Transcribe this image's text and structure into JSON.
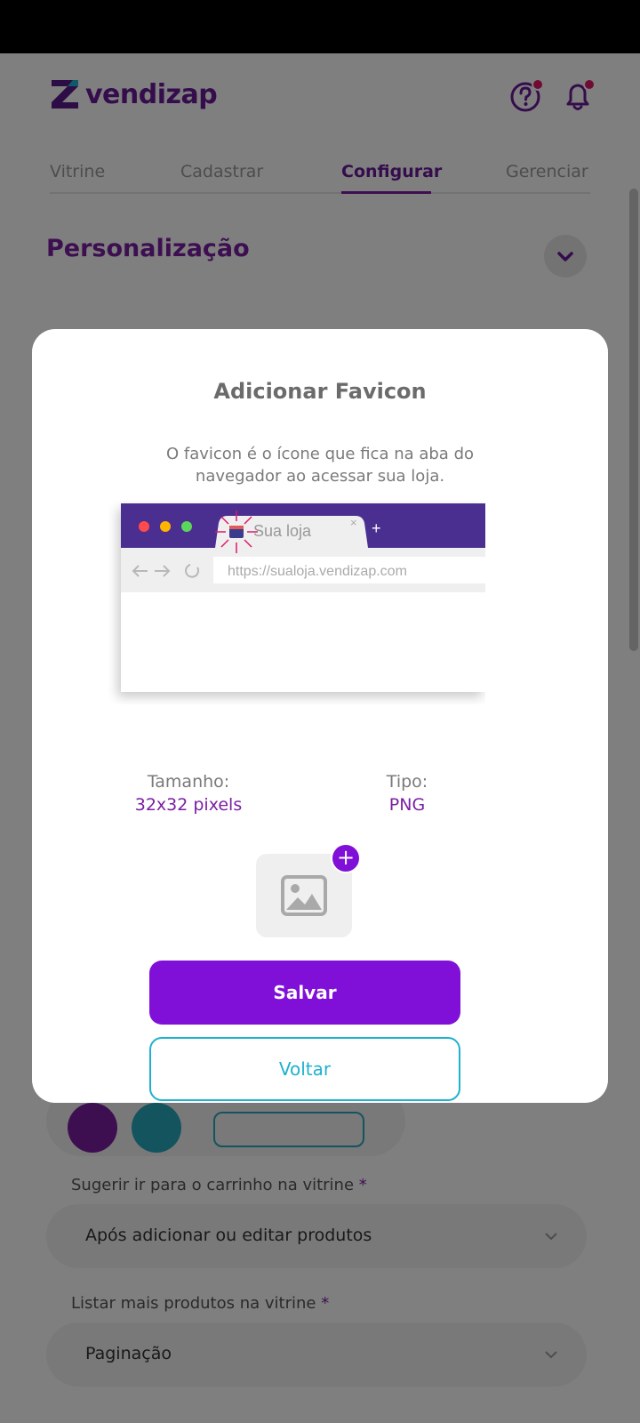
{
  "app": {
    "logo_text": "vendizap"
  },
  "tabs": [
    {
      "label": "Vitrine"
    },
    {
      "label": "Cadastrar"
    },
    {
      "label": "Configurar",
      "active": true
    },
    {
      "label": "Gerenciar"
    }
  ],
  "section": {
    "title": "Personalização"
  },
  "fields": [
    {
      "label": "Sugerir ir para o carrinho na vitrine",
      "required_mark": "*",
      "value": "Após adicionar ou editar produtos"
    },
    {
      "label": "Listar mais produtos na vitrine",
      "required_mark": "*",
      "value": "Paginação"
    }
  ],
  "modal": {
    "title": "Adicionar Favicon",
    "description": "O favicon é o ícone que fica na aba do navegador ao acessar sua loja.",
    "illustration": {
      "tab_title": "Sua loja",
      "url": "https://sualoja.vendizap.com",
      "tab_close": "×",
      "new_tab": "+"
    },
    "size_label": "Tamanho:",
    "size_value": "32x32 pixels",
    "type_label": "Tipo:",
    "type_value": "PNG",
    "upload_plus": "+",
    "save_label": "Salvar",
    "back_label": "Voltar"
  },
  "colors": {
    "brand_purple": "#7b1fa2",
    "button_purple": "#8010d8",
    "teal": "#1fb1cf",
    "notification_dot": "#e0176a"
  },
  "icons": [
    "help-icon",
    "bell-icon",
    "chevron-down-icon",
    "image-placeholder-icon",
    "add-icon"
  ]
}
